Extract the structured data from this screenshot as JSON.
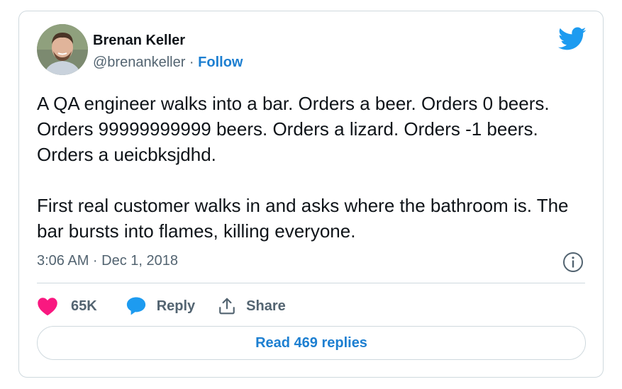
{
  "author": {
    "name": "Brenan Keller",
    "handle": "@brenankeller",
    "separator": " · ",
    "follow_label": "Follow"
  },
  "tweet": {
    "text": "A QA engineer walks into a bar. Orders a beer. Orders 0 beers. Orders 99999999999 beers. Orders a lizard. Orders -1 beers. Orders a ueicbksjdhd.\n\nFirst real customer walks in and asks where the bathroom is. The bar bursts into flames, killing everyone.",
    "timestamp": "3:06 AM · Dec 1, 2018"
  },
  "actions": {
    "likes_count": "65K",
    "reply_label": "Reply",
    "share_label": "Share"
  },
  "footer": {
    "read_replies_label": "Read 469 replies"
  },
  "colors": {
    "accent": "#1d7fd1",
    "twitter_blue": "#1d9bf0",
    "like_pink": "#f91880",
    "muted": "#536471",
    "border": "#cfd9de"
  },
  "icons": {
    "brand": "twitter-bird-icon",
    "info": "info-circle-icon",
    "like": "heart-icon",
    "reply": "speech-bubble-icon",
    "share": "share-upload-icon"
  }
}
